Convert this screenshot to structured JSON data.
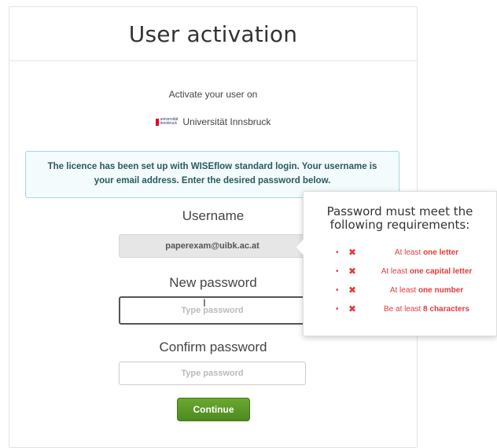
{
  "header": {
    "title": "User activation"
  },
  "intro": {
    "activate_text": "Activate your user on",
    "org_logo_line1": "universität",
    "org_logo_line2": "innsbruck",
    "org_name": "Universität Innsbruck"
  },
  "info": {
    "message": "The licence has been set up with WISEflow standard login. Your username is your email address. Enter the desired password below."
  },
  "form": {
    "username_label": "Username",
    "username_value": "paperexam@uibk.ac.at",
    "new_password_label": "New password",
    "new_password_placeholder": "Type password",
    "confirm_password_label": "Confirm password",
    "confirm_password_placeholder": "Type password",
    "submit_label": "Continue"
  },
  "requirements": {
    "title": "Password must meet the following requirements:",
    "items": [
      {
        "prefix": "At least ",
        "bold": "one letter",
        "suffix": ""
      },
      {
        "prefix": "At least ",
        "bold": "one capital letter",
        "suffix": ""
      },
      {
        "prefix": "At least ",
        "bold": "one number",
        "suffix": ""
      },
      {
        "prefix": "Be at least ",
        "bold": "8 characters",
        "suffix": ""
      }
    ]
  },
  "colors": {
    "accent_green": "#5a9a28",
    "error_red": "#e03c3c",
    "info_bg": "#f3fbfc"
  }
}
